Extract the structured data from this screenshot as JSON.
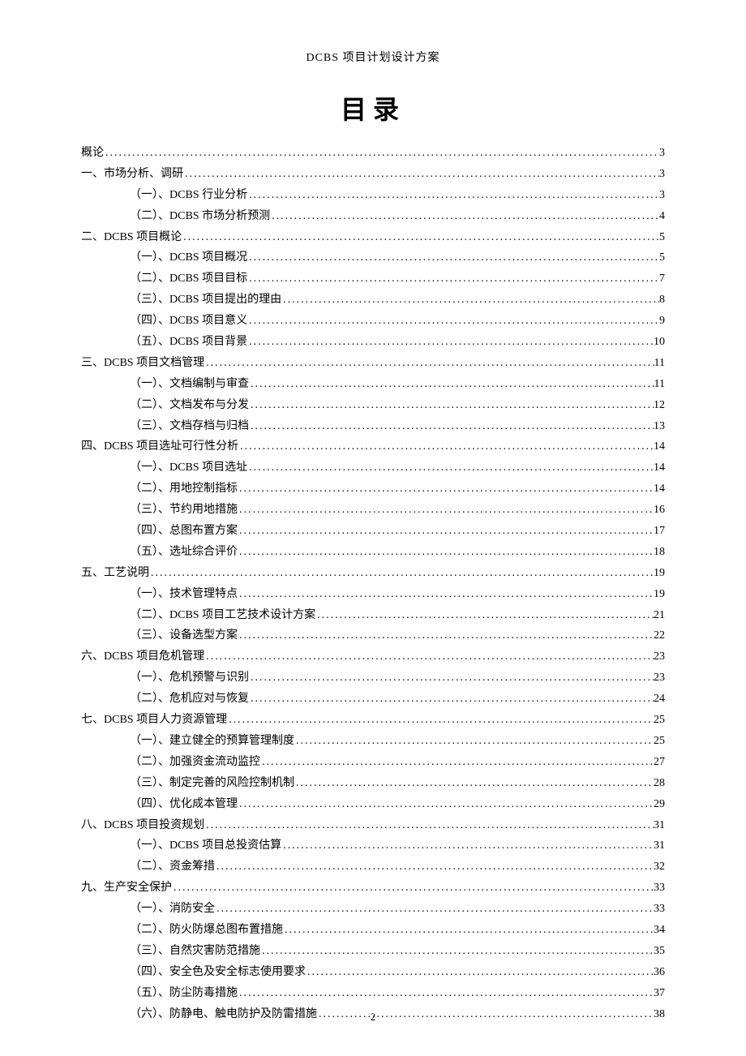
{
  "header": "DCBS 项目计划设计方案",
  "title": "目录",
  "pageNumber": "2",
  "toc": [
    {
      "level": 0,
      "label": "概论",
      "page": "3"
    },
    {
      "level": 0,
      "label": "一、市场分析、调研",
      "page": "3"
    },
    {
      "level": 1,
      "label": "（一）、DCBS 行业分析",
      "page": "3"
    },
    {
      "level": 1,
      "label": "（二）、DCBS 市场分析预测",
      "page": "4"
    },
    {
      "level": 0,
      "label": "二、DCBS 项目概论",
      "page": "5"
    },
    {
      "level": 1,
      "label": "（一）、DCBS 项目概况",
      "page": "5"
    },
    {
      "level": 1,
      "label": "（二）、DCBS 项目目标",
      "page": "7"
    },
    {
      "level": 1,
      "label": "（三）、DCBS 项目提出的理由",
      "page": "8"
    },
    {
      "level": 1,
      "label": "（四）、DCBS 项目意义",
      "page": "9"
    },
    {
      "level": 1,
      "label": "（五）、DCBS 项目背景",
      "page": "10"
    },
    {
      "level": 0,
      "label": "三、DCBS 项目文档管理",
      "page": "11"
    },
    {
      "level": 1,
      "label": "（一）、文档编制与审查",
      "page": "11"
    },
    {
      "level": 1,
      "label": "（二）、文档发布与分发",
      "page": "12"
    },
    {
      "level": 1,
      "label": "（三）、文档存档与归档",
      "page": "13"
    },
    {
      "level": 0,
      "label": "四、DCBS 项目选址可行性分析",
      "page": "14"
    },
    {
      "level": 1,
      "label": "（一）、DCBS 项目选址",
      "page": "14"
    },
    {
      "level": 1,
      "label": "（二）、用地控制指标",
      "page": "14"
    },
    {
      "level": 1,
      "label": "（三）、节约用地措施",
      "page": "16"
    },
    {
      "level": 1,
      "label": "（四）、总图布置方案",
      "page": "17"
    },
    {
      "level": 1,
      "label": "（五）、选址综合评价",
      "page": "18"
    },
    {
      "level": 0,
      "label": "五、工艺说明",
      "page": "19"
    },
    {
      "level": 1,
      "label": "（一）、技术管理特点",
      "page": "19"
    },
    {
      "level": 1,
      "label": "（二）、DCBS 项目工艺技术设计方案",
      "page": "21"
    },
    {
      "level": 1,
      "label": "（三）、设备选型方案",
      "page": "22"
    },
    {
      "level": 0,
      "label": "六、DCBS 项目危机管理",
      "page": "23"
    },
    {
      "level": 1,
      "label": "（一）、危机预警与识别",
      "page": "23"
    },
    {
      "level": 1,
      "label": "（二）、危机应对与恢复",
      "page": "24"
    },
    {
      "level": 0,
      "label": "七、DCBS 项目人力资源管理",
      "page": "25"
    },
    {
      "level": 1,
      "label": "（一）、建立健全的预算管理制度",
      "page": "25"
    },
    {
      "level": 1,
      "label": "（二）、加强资金流动监控",
      "page": "27"
    },
    {
      "level": 1,
      "label": "（三）、制定完善的风险控制机制",
      "page": "28"
    },
    {
      "level": 1,
      "label": "（四）、优化成本管理",
      "page": "29"
    },
    {
      "level": 0,
      "label": "八、DCBS 项目投资规划",
      "page": "31"
    },
    {
      "level": 1,
      "label": "（一）、DCBS 项目总投资估算",
      "page": "31"
    },
    {
      "level": 1,
      "label": "（二）、资金筹措",
      "page": "32"
    },
    {
      "level": 0,
      "label": "九、生产安全保护",
      "page": "33"
    },
    {
      "level": 1,
      "label": "（一）、消防安全",
      "page": "33"
    },
    {
      "level": 1,
      "label": "（二）、防火防爆总图布置措施",
      "page": "34"
    },
    {
      "level": 1,
      "label": "（三）、自然灾害防范措施",
      "page": "35"
    },
    {
      "level": 1,
      "label": "（四）、安全色及安全标志使用要求",
      "page": "36"
    },
    {
      "level": 1,
      "label": "（五）、防尘防毒措施",
      "page": "37"
    },
    {
      "level": 1,
      "label": "（六）、防静电、触电防护及防雷措施",
      "page": "38"
    }
  ]
}
